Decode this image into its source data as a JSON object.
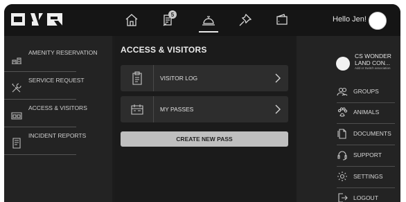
{
  "app": {
    "logo_icon": "onr-logo",
    "greeting": "Hello Jen!"
  },
  "topnav": {
    "icons": [
      "home-icon",
      "notes-icon",
      "service-bell-icon",
      "pushpin-icon",
      "wallet-icon"
    ],
    "notification_count": "5",
    "active": "service-bell-icon"
  },
  "sidebar": {
    "items": [
      {
        "label": "AMENITY RESERVATION",
        "icon": "amenity-icon"
      },
      {
        "label": "SERVICE REQUEST",
        "icon": "tools-icon"
      },
      {
        "label": "ACCESS & VISITORS",
        "icon": "access-icon"
      },
      {
        "label": "INCIDENT REPORTS",
        "icon": "report-icon"
      }
    ]
  },
  "main": {
    "title": "ACCESS & VISITORS",
    "cards": [
      {
        "label": "VISITOR LOG",
        "icon": "clipboard-icon"
      },
      {
        "label": "MY PASSES",
        "icon": "calendar-pass-icon"
      }
    ],
    "create_button": "CREATE NEW PASS"
  },
  "community": {
    "name": "CS WONDER LAND CON...",
    "subtitle": "Add or Switch association"
  },
  "right_menu": {
    "items": [
      {
        "label": "GROUPS",
        "icon": "groups-icon"
      },
      {
        "label": "ANIMALS",
        "icon": "paw-icon"
      },
      {
        "label": "DOCUMENTS",
        "icon": "documents-icon"
      },
      {
        "label": "SUPPORT",
        "icon": "headset-icon"
      },
      {
        "label": "SETTINGS",
        "icon": "gear-icon"
      },
      {
        "label": "LOGOUT",
        "icon": "logout-icon"
      }
    ]
  },
  "colors": {
    "background": "#1c1c1c",
    "panel": "#232323",
    "card": "#2d2d2d",
    "button": "#bfbfbf",
    "text": "#e0e0e0"
  }
}
